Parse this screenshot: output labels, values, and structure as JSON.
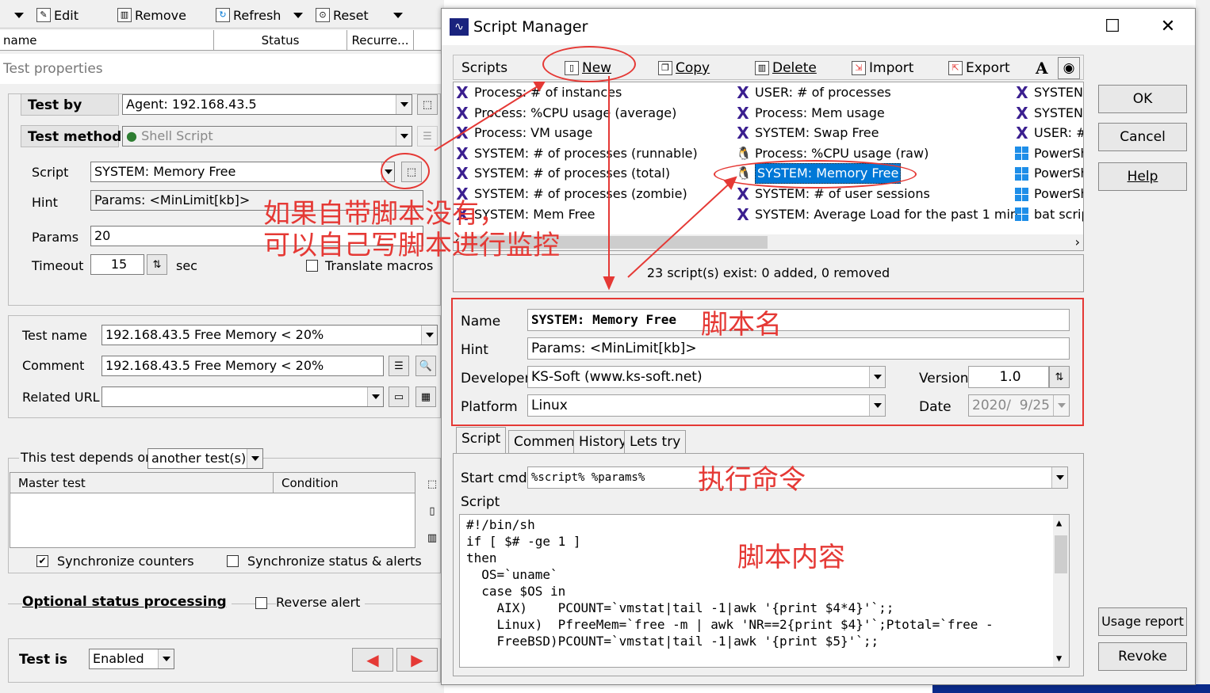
{
  "left_toolbar": {
    "edit": "Edit",
    "remove": "Remove",
    "refresh": "Refresh",
    "reset": "Reset"
  },
  "list_header": {
    "name": "name",
    "status": "Status",
    "recurrence": "Recurre..."
  },
  "section_title": "Test properties",
  "test_by": {
    "label": "Test by",
    "value": "Agent: 192.168.43.5"
  },
  "test_method": {
    "label": "Test method",
    "value": "Shell Script"
  },
  "script": {
    "label": "Script",
    "value": "SYSTEM: Memory Free"
  },
  "hint": {
    "label": "Hint",
    "value": "Params: <MinLimit[kb]>"
  },
  "params": {
    "label": "Params",
    "value": "20"
  },
  "timeout": {
    "label": "Timeout",
    "value": "15",
    "unit": "sec"
  },
  "translate_macros": "Translate macros",
  "test_name": {
    "label": "Test name",
    "value": "192.168.43.5 Free Memory < 20%"
  },
  "comment": {
    "label": "Comment",
    "value": "192.168.43.5 Free Memory < 20%"
  },
  "related_url": {
    "label": "Related URL",
    "value": ""
  },
  "depends": {
    "label": "This test depends on",
    "value": "another test(s)"
  },
  "dep_table": {
    "col_master": "Master test",
    "col_condition": "Condition"
  },
  "sync_counters": "Synchronize counters",
  "sync_status": "Synchronize status & alerts",
  "optional_status": "Optional status processing",
  "reverse_alert": "Reverse alert",
  "test_is": {
    "label": "Test is",
    "value": "Enabled"
  },
  "dialog": {
    "title": "Script Manager",
    "toolbar": {
      "scripts": "Scripts",
      "new": "New",
      "copy": "Copy",
      "delete": "Delete",
      "import": "Import",
      "export": "Export"
    },
    "col1": [
      {
        "icon": "x",
        "label": "Process: # of instances"
      },
      {
        "icon": "x",
        "label": "Process: %CPU usage (average)"
      },
      {
        "icon": "x",
        "label": "Process: VM usage"
      },
      {
        "icon": "x",
        "label": "SYSTEM: # of processes (runnable)"
      },
      {
        "icon": "x",
        "label": "SYSTEM: # of processes (total)"
      },
      {
        "icon": "x",
        "label": "SYSTEM: # of processes (zombie)"
      },
      {
        "icon": "x",
        "label": "SYSTEM: Mem Free"
      }
    ],
    "col2": [
      {
        "icon": "x",
        "label": "USER: # of processes"
      },
      {
        "icon": "x",
        "label": "Process: Mem usage"
      },
      {
        "icon": "x",
        "label": "SYSTEM: Swap Free"
      },
      {
        "icon": "tux",
        "label": "Process: %CPU usage (raw)"
      },
      {
        "icon": "tux",
        "label": "SYSTEM: Memory Free"
      },
      {
        "icon": "x",
        "label": "SYSTEM: # of user sessions"
      },
      {
        "icon": "x",
        "label": "SYSTEM: Average Load for the past 1 min"
      }
    ],
    "col3": [
      {
        "icon": "x",
        "label": "SYSTEN"
      },
      {
        "icon": "x",
        "label": "SYSTEN"
      },
      {
        "icon": "x",
        "label": "USER: #"
      },
      {
        "icon": "win",
        "label": "PowerSh"
      },
      {
        "icon": "win",
        "label": "PowerSh"
      },
      {
        "icon": "win",
        "label": "PowerSh"
      },
      {
        "icon": "win",
        "label": "bat scrip"
      }
    ],
    "status": "23 script(s) exist: 0 added, 0 removed",
    "name": {
      "label": "Name",
      "value": "SYSTEM: Memory Free"
    },
    "hint": {
      "label": "Hint",
      "value": "Params: <MinLimit[kb]>"
    },
    "developer": {
      "label": "Developer",
      "value": "KS-Soft (www.ks-soft.net)"
    },
    "version": {
      "label": "Version",
      "value": "1.0"
    },
    "platform": {
      "label": "Platform",
      "value": "Linux"
    },
    "date": {
      "label": "Date",
      "value": "2020/  9/25"
    },
    "tabs": [
      "Script",
      "Comment",
      "History",
      "Lets try"
    ],
    "start_cmd": {
      "label": "Start cmd",
      "value": "%script% %params%"
    },
    "script_label": "Script",
    "code": "#!/bin/sh\nif [ $# -ge 1 ]\nthen\n  OS=`uname`\n  case $OS in\n    AIX)    PCOUNT=`vmstat|tail -1|awk '{print $4*4}'`;;\n    Linux)  PfreeMem=`free -m | awk 'NR==2{print $4}'`;Ptotal=`free -\n    FreeBSD)PCOUNT=`vmstat|tail -1|awk '{print $5}'`;;",
    "buttons": {
      "ok": "OK",
      "cancel": "Cancel",
      "help": "Help",
      "usage": "Usage report",
      "revoke": "Revoke"
    }
  },
  "annotations": {
    "custom_script": "如果自带脚本没有，\n可以自己写脚本进行监控",
    "script_name": "脚本名",
    "exec_cmd": "执行命令",
    "script_content": "脚本内容"
  },
  "colors": {
    "annotation": "#e53935",
    "selection": "#0078d7",
    "script_icon": "#3b1f8f"
  }
}
